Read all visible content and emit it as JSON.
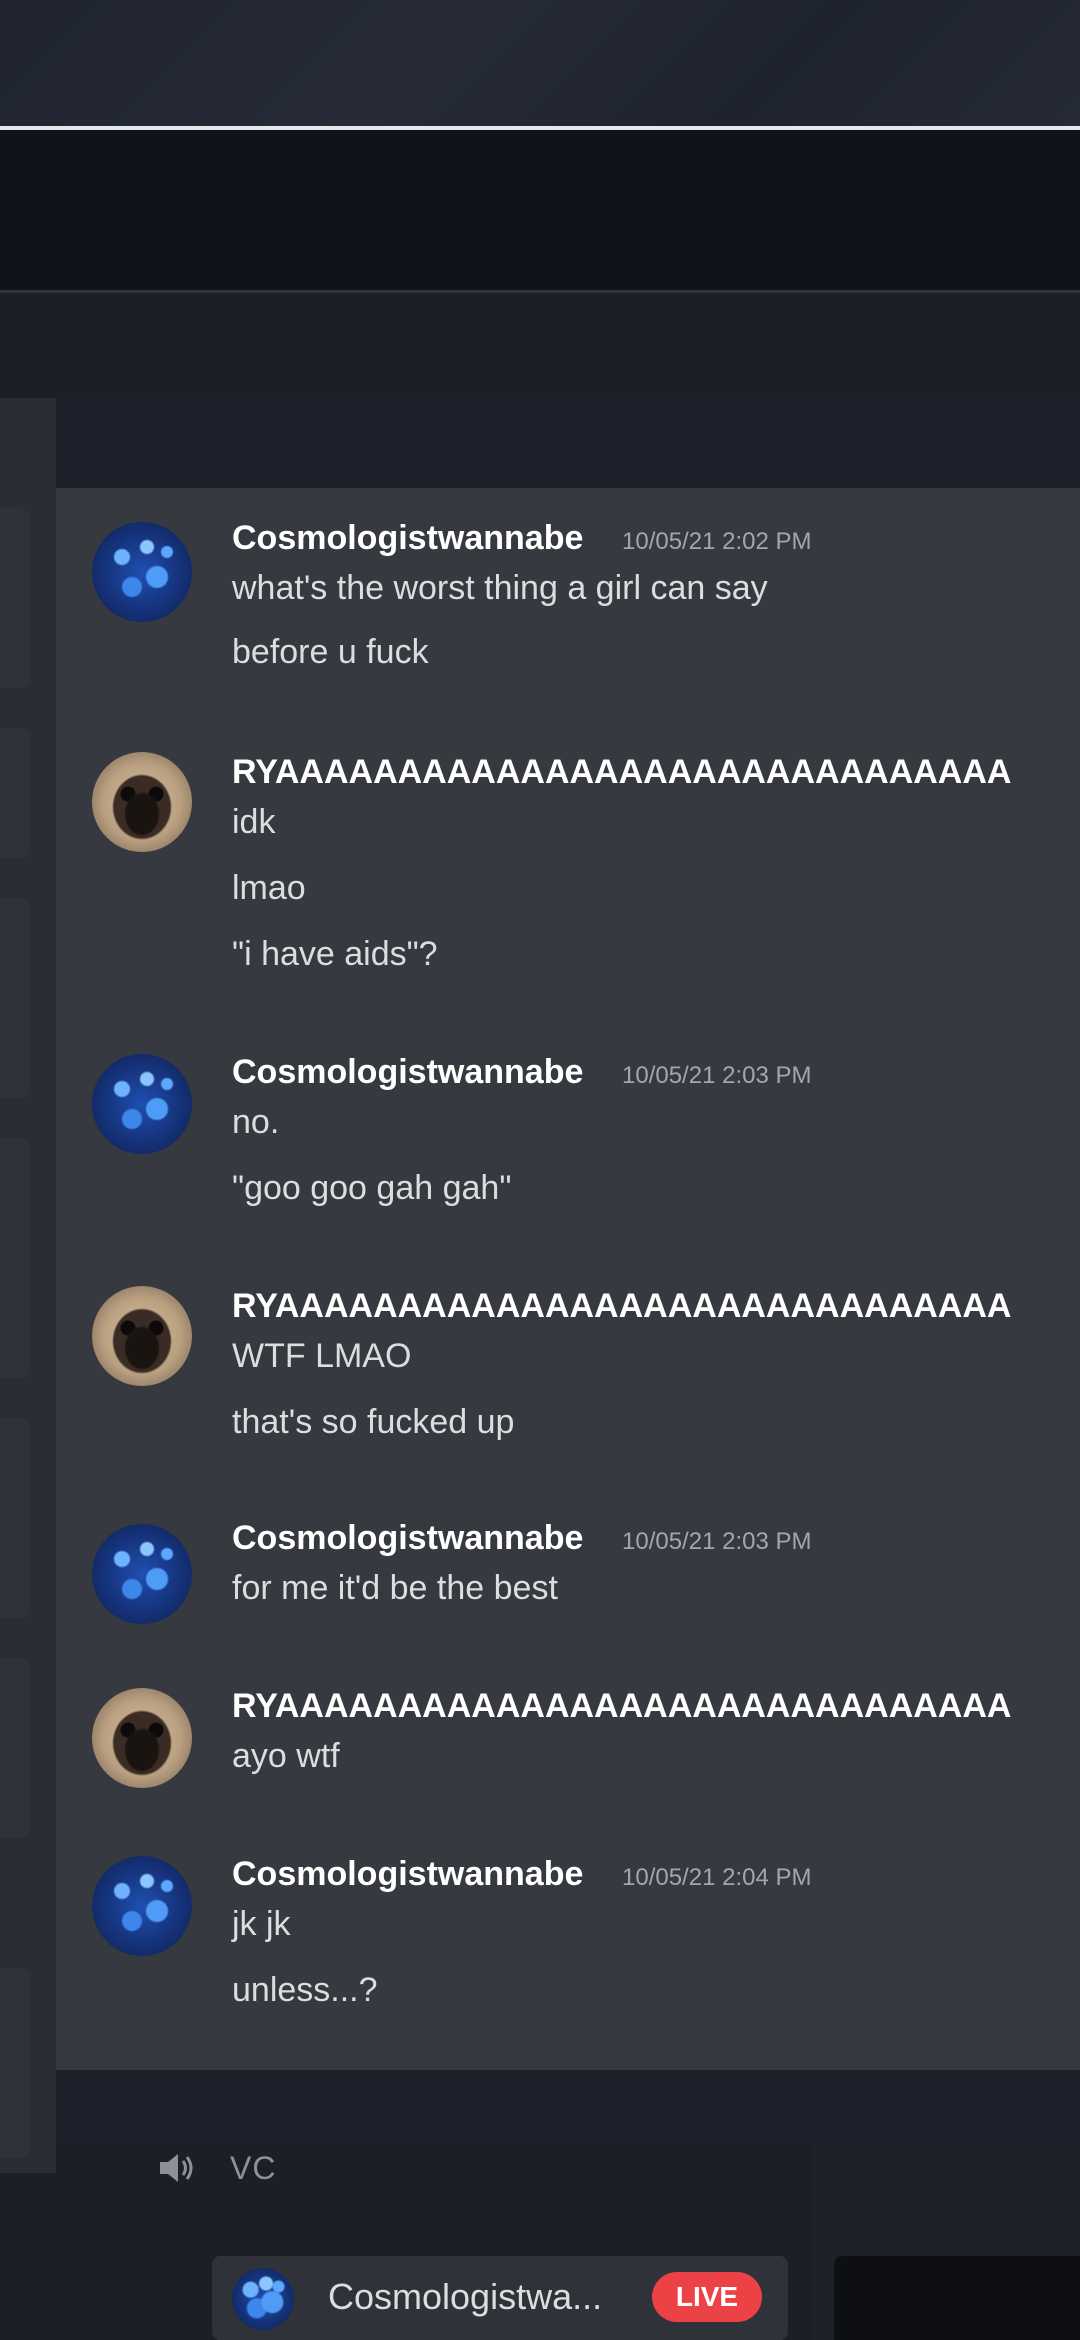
{
  "chat": {
    "messages": [
      {
        "author": "Cosmologistwannabe",
        "avatar": "galaxy-avatar",
        "timestamp": "10/05/21 2:02 PM",
        "lines": [
          "what's the worst thing a girl can say",
          "before u fuck"
        ]
      },
      {
        "author": "RYAAAAAAAAAAAAAAAAAAAAAAAAAAAAAA",
        "avatar": "pug-avatar",
        "timestamp": "",
        "lines": [
          "idk",
          "lmao",
          "\"i have aids\"?"
        ]
      },
      {
        "author": "Cosmologistwannabe",
        "avatar": "galaxy-avatar",
        "timestamp": "10/05/21 2:03 PM",
        "lines": [
          "no.",
          "\"goo goo gah gah\""
        ]
      },
      {
        "author": "RYAAAAAAAAAAAAAAAAAAAAAAAAAAAAAA",
        "avatar": "pug-avatar",
        "timestamp": "",
        "lines": [
          "WTF LMAO",
          "that's so fucked up"
        ]
      },
      {
        "author": "Cosmologistwannabe",
        "avatar": "galaxy-avatar",
        "timestamp": "10/05/21 2:03 PM",
        "lines": [
          "for me it'd be the best"
        ]
      },
      {
        "author": "RYAAAAAAAAAAAAAAAAAAAAAAAAAAAAAA",
        "avatar": "pug-avatar",
        "timestamp": "",
        "lines": [
          "ayo wtf"
        ]
      },
      {
        "author": "Cosmologistwannabe",
        "avatar": "galaxy-avatar",
        "timestamp": "10/05/21 2:04 PM",
        "lines": [
          "jk jk",
          "unless...?"
        ]
      }
    ]
  },
  "voice": {
    "channel_icon": "speaker-icon",
    "channel_name": "VC",
    "user": "Cosmologistwa...",
    "live_label": "LIVE"
  },
  "colors": {
    "chat_bg": "#36393f",
    "live_red": "#ed4245"
  }
}
